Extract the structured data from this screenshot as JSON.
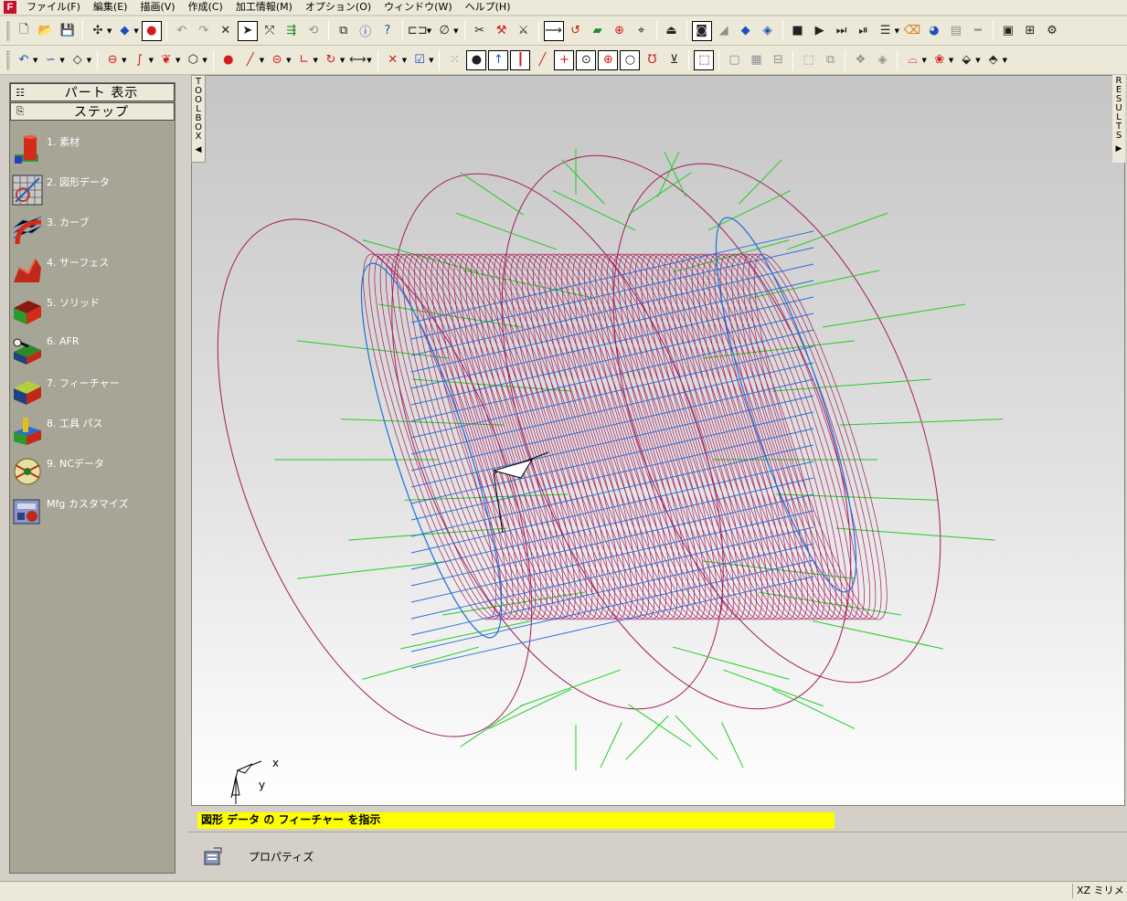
{
  "menu": {
    "app_icon": "F",
    "items": [
      "ファイル(F)",
      "編集(E)",
      "描画(V)",
      "作成(C)",
      "加工情報(M)",
      "オプション(O)",
      "ウィンドウ(W)",
      "ヘルプ(H)"
    ]
  },
  "left_panel": {
    "tabs": {
      "part_view": "パート 表示",
      "steps": "ステップ"
    },
    "steps": [
      {
        "label": "1. 素材",
        "icon": "stock-icon"
      },
      {
        "label": "2. 図形データ",
        "icon": "geometry-data-icon"
      },
      {
        "label": "3. カーブ",
        "icon": "curve-icon"
      },
      {
        "label": "4. サーフェス",
        "icon": "surface-icon"
      },
      {
        "label": "5. ソリッド",
        "icon": "solid-icon"
      },
      {
        "label": "6. AFR",
        "icon": "afr-icon"
      },
      {
        "label": "7. フィーチャー",
        "icon": "feature-icon"
      },
      {
        "label": "8. 工具 パス",
        "icon": "toolpath-icon"
      },
      {
        "label": "9. NCデータ",
        "icon": "nc-data-icon"
      },
      {
        "label": "Mfg カスタマイズ",
        "icon": "mfg-customize-icon"
      }
    ]
  },
  "strips": {
    "toolbox": [
      "T",
      "O",
      "O",
      "L",
      "B",
      "O",
      "X"
    ],
    "results": [
      "R",
      "E",
      "S",
      "U",
      "L",
      "T",
      "S"
    ]
  },
  "viewport": {
    "axis_x": "x",
    "axis_y": "y"
  },
  "prompt": "図形 データ の フィーチャー を指示",
  "properties": {
    "label": "プロパティズ",
    "icon": "properties-icon"
  },
  "status": {
    "plane_units": "XZ ミリメ"
  },
  "colors": {
    "wire_magenta": "#a3195b",
    "wire_green": "#22cc22",
    "wire_blue": "#1e6fd9",
    "prompt_bg": "#ffff00",
    "panel_bg": "#a7a595"
  }
}
